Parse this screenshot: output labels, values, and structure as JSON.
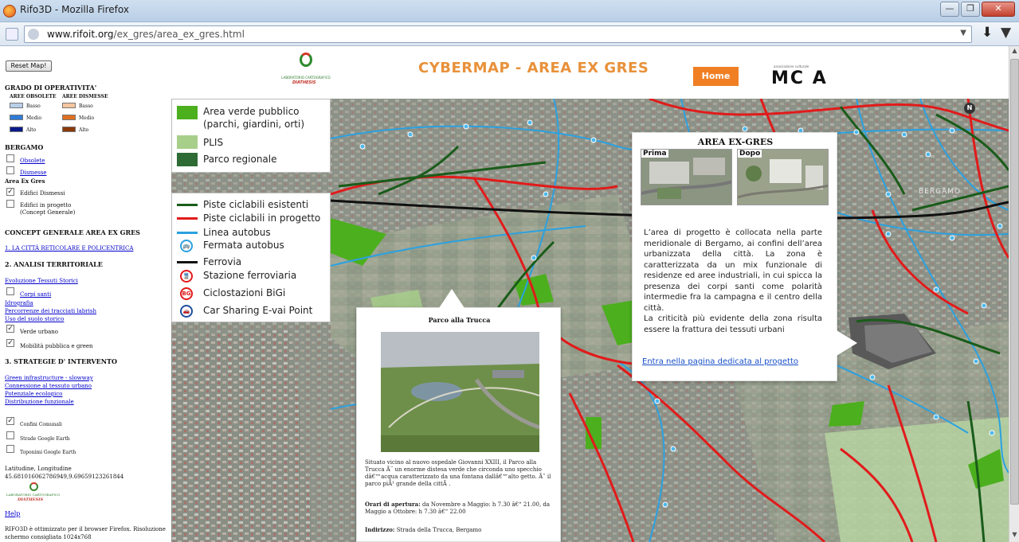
{
  "browser": {
    "window_title": "Rifo3D - Mozilla Firefox",
    "url_host": "www.rifoit.org",
    "url_path": "/ex_gres/area_ex_gres.html",
    "minimize": "—",
    "maximize": "❐",
    "close": "✕",
    "url_dropdown": "▼",
    "download_glyph": "⬇",
    "menu_glyph": "▼"
  },
  "header": {
    "title": "CYBERMAP - AREA EX GRES",
    "home_button": "Home",
    "brand_caption": "LABORATORIO CARTOGRAFICO",
    "brand_name": "DIATHESIS",
    "mca_label": "MC A",
    "mca_caption": "associazione culturale"
  },
  "sidebar": {
    "reset_button": "Reset Map!",
    "operativita_heading": "GRADO DI OPERATIVITA'",
    "aree_obsolete": "AREE OBSOLETE",
    "aree_dismesse": "AREE DISMESSE",
    "levels_obsolete": [
      {
        "label": "Basso",
        "color": "#b8cfe8"
      },
      {
        "label": "Medio",
        "color": "#2f7bd8"
      },
      {
        "label": "Alto",
        "color": "#0a1a8a"
      }
    ],
    "levels_dismesse": [
      {
        "label": "Basso",
        "color": "#f5c6a0"
      },
      {
        "label": "Medio",
        "color": "#e07020"
      },
      {
        "label": "Alto",
        "color": "#8a3a0a"
      }
    ],
    "bergamo_heading": "BERGAMO",
    "obsolete_link": "Obsolete",
    "dismesse_link": "Dismesse",
    "area_ex_gres": "Area Ex Gres",
    "edifici_dismessi": "Edifici Dismessi",
    "edifici_progetto": "Edifici in progetto",
    "concept_generale_paren": "(Concept Generale)",
    "concept_heading": "CONCEPT GENERALE AREA EX GRES",
    "citta_link": "1. LA CITTÀ RETICOLARE E POLICENTRICA",
    "analisi_heading": "2. ANALISI TERRITORIALE",
    "evoluzione_link": "Evoluzione Tessuti Storici",
    "corpi_santi": "Corpi santi",
    "idrografia_link": "Idrografia",
    "percorsi_link": "Percorrenze dei tracciati labrish",
    "usi_link": "Uso del suolo storico",
    "verde_urbano": "Verde urbano",
    "mobilita": "Mobilità pubblica e green",
    "strategie_heading": "3. STRATEGIE D' INTERVENTO",
    "green_link": "Green infrastructure - slowway",
    "connessione_link": "Connessione al tessuto urbano",
    "potenziale_link": "Potenziale ecologico",
    "distribuzione_link": "Distribuzione funzionale",
    "confini_comunali": "Confini Comunali",
    "strade_ge": "Strade Google Earth",
    "toponimi_ge": "Toponimi Google Earth",
    "latlon_label": "Latitudine, Longitudine",
    "latlon_value": "45.681016062786949,9.69659123261844",
    "lab_caption": "LABORATORIO CARTOGRAFICO",
    "lab_name": "DIATHESIS",
    "help_link": "Help",
    "footer_line1": "RIFO3D è ottimizzato per il browser Firefox. Risoluzione",
    "footer_line2": "schermo consigliata 1024x768"
  },
  "legend_areas": [
    {
      "label1": "Area verde pubblico",
      "label2": "(parchi, giardini, orti)",
      "color": "#4caf1e"
    },
    {
      "label1": "PLIS",
      "color": "#a8cf8a"
    },
    {
      "label1": "Parco regionale",
      "color": "#2e6b35"
    }
  ],
  "legend_lines": [
    {
      "label": "Piste ciclabili esistenti",
      "color": "#1a5c1a"
    },
    {
      "label": "Piste ciclabili in progetto",
      "color": "#e11b1b"
    },
    {
      "label": "Linea autobus",
      "color": "#2ba1e0"
    },
    {
      "label": "Fermata autobus",
      "color": "#2ba1e0",
      "icon": "🚌"
    },
    {
      "label": "Ferrovia",
      "color": "#111111"
    },
    {
      "label": "Stazione ferroviaria",
      "color": "#e11b1b",
      "icon": "🚆"
    },
    {
      "label": "Ciclostazioni BiGi",
      "color": "#e11b1b",
      "icon": "BG"
    },
    {
      "label": "Car Sharing E-vai Point",
      "color": "#1f4fa0",
      "icon": "🚗"
    }
  ],
  "popup_exgres": {
    "title": "AREA EX-GRES",
    "prima": "Prima",
    "dopo": "Dopo",
    "paragraph1": "L’area di progetto è collocata nella parte meridionale di Bergamo, ai confini dell’area urbanizzata della città. La zona è caratterizzata da un mix funzionale di residenze ed aree industriali, in cui spicca la presenza dei corpi santi come polarità intermedie fra la campagna e il centro della città.",
    "paragraph2": "La criticità più evidente della zona risulta essere la frattura dei tessuti urbani",
    "link": "Entra nella pagina dedicata al progetto"
  },
  "popup_trucca": {
    "title": "Parco alla Trucca",
    "description": "Situato vicino al nuovo ospedale Giovanni XXIII, il Parco alla Trucca Ã¨ un enorme distesa verde che circonda uno specchio dâ€™acqua caratterizzato da una fontana dallâ€™alto getto. Ãˆ il parco piÃ¹ grande della cittÃ .",
    "hours_label": "Orari di apertura:",
    "hours_text": "da Novembre a Maggio: h 7.30 â€“ 21.00, da Maggio a Ottobre: h 7.30 â€“ 22.00",
    "address_label": "Indirizzo:",
    "address_text": "Strada della Trucca, Bergamo"
  },
  "map": {
    "city_label": "BERGAMO",
    "north_label": "N"
  }
}
